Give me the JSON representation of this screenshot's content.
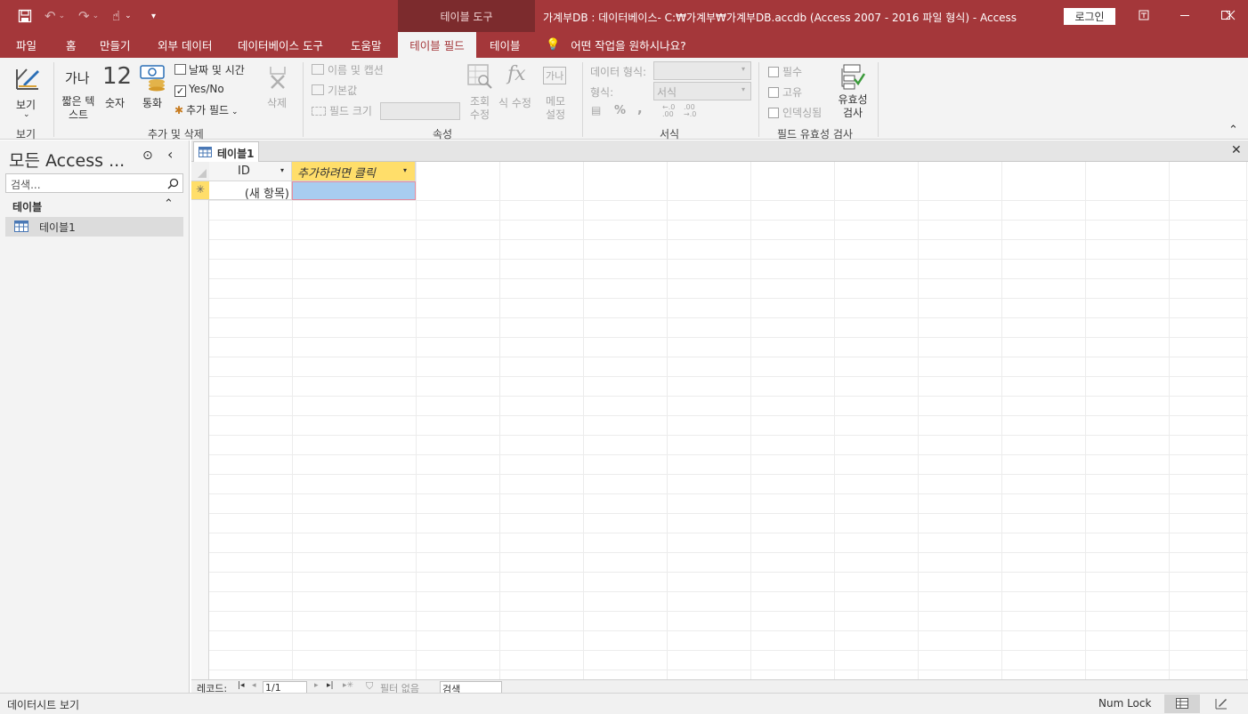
{
  "titlebar": {
    "context_group": "테이블 도구",
    "window_title": "가계부DB : 데이터베이스- C:₩가계부₩가계부DB.accdb (Access 2007 - 2016 파일 형식)  -  Access",
    "login_label": "로그인"
  },
  "tabs": [
    "파일",
    "홈",
    "만들기",
    "외부 데이터",
    "데이터베이스 도구",
    "도움말",
    "테이블 필드",
    "테이블"
  ],
  "tell_me": "어떤 작업을 원하시나요?",
  "ribbon": {
    "view": {
      "label": "보기",
      "group": "보기"
    },
    "add_delete": {
      "short_text_glyph": "가나",
      "short_text": "짧은 텍스트",
      "number_glyph": "12",
      "number": "숫자",
      "currency": "통화",
      "date_time": "날짜 및 시간",
      "yes_no": "Yes/No",
      "more_fields": "추가 필드",
      "delete": "삭제",
      "group": "추가 및 삭제"
    },
    "properties": {
      "name_caption": "이름 및 캡션",
      "default_value": "기본값",
      "field_size": "필드 크기",
      "modify_lookups": "조회 수정",
      "expression": "식 수정",
      "memo_glyph": "가나",
      "memo_settings": "메모 설정",
      "group": "속성"
    },
    "formatting": {
      "data_type_label": "데이터 형식:",
      "format_label": "형식:",
      "format_value": "서식",
      "group": "서식"
    },
    "validation": {
      "required": "필수",
      "unique": "고유",
      "indexed": "인덱싱됨",
      "validation": "유효성 검사",
      "group": "필드 유효성 검사"
    }
  },
  "nav": {
    "title": "모든 Access ...",
    "search_placeholder": "검색...",
    "section": "테이블",
    "items": [
      "테이블1"
    ]
  },
  "document": {
    "tab": "테이블1",
    "columns": [
      "ID",
      "추가하려면 클릭"
    ],
    "new_row": "(새 항목)"
  },
  "record_nav": {
    "label": "레코드:",
    "position": "1/1",
    "filter": "필터 없음",
    "search": "검색"
  },
  "status": {
    "mode": "데이터시트 보기",
    "numlock": "Num Lock"
  },
  "colors": {
    "accent": "#a4373a",
    "context": "#7c2b2d",
    "add_col": "#ffde6a",
    "selected": "#a8cdf0"
  }
}
